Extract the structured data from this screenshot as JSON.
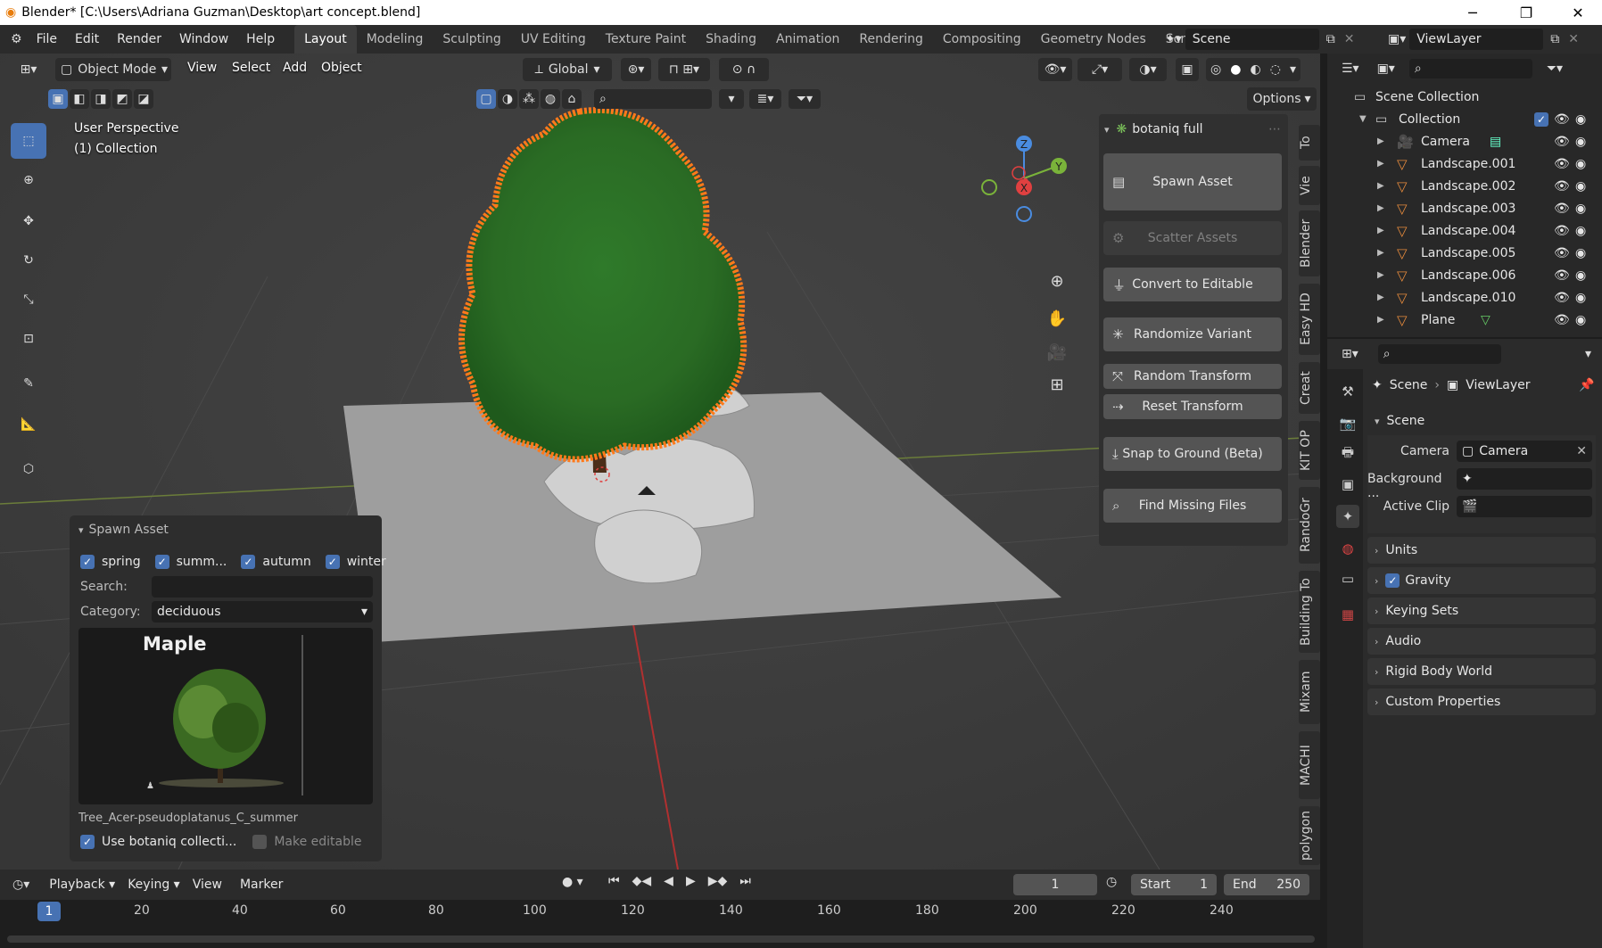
{
  "window": {
    "title": "Blender* [C:\\Users\\Adriana Guzman\\Desktop\\art concept.blend]",
    "minimize": "─",
    "maximize": "❐",
    "close": "✕"
  },
  "menu": {
    "items": [
      "File",
      "Edit",
      "Render",
      "Window",
      "Help"
    ],
    "workspaces": [
      "Layout",
      "Modeling",
      "Sculpting",
      "UV Editing",
      "Texture Paint",
      "Shading",
      "Animation",
      "Rendering",
      "Compositing",
      "Geometry Nodes",
      "Scripting"
    ],
    "active_workspace": "Layout",
    "scene": "Scene",
    "view_layer": "ViewLayer"
  },
  "viewport": {
    "mode": "Object Mode",
    "menus": [
      "View",
      "Select",
      "Add",
      "Object"
    ],
    "orientation": "Global",
    "options": "Options",
    "perspective": "User Perspective",
    "collection": "(1) Collection",
    "gizmo": {
      "x": "X",
      "y": "Y",
      "z": "Z"
    }
  },
  "npanel": {
    "title": "botaniq full",
    "buttons": [
      "Spawn Asset",
      "Scatter Assets",
      "Convert to Editable",
      "Randomize Variant",
      "Random Transform",
      "Reset Transform",
      "Snap to Ground (Beta)",
      "Find Missing Files"
    ],
    "tabs": [
      "To",
      "Vie",
      "Blender",
      "Easy HD",
      "Creat",
      "KIT OP",
      "RandoGr",
      "Building To",
      "Mixam",
      "MACHI",
      "polygon"
    ]
  },
  "spawn_asset": {
    "title": "Spawn Asset",
    "seasons": [
      "spring",
      "summ...",
      "autumn",
      "winter"
    ],
    "search_label": "Search:",
    "search_value": "",
    "category_label": "Category:",
    "category_value": "deciduous",
    "preview_title": "Maple",
    "asset_name": "Tree_Acer-pseudoplatanus_C_summer",
    "use_collection": "Use botaniq collecti...",
    "make_editable": "Make editable"
  },
  "outliner": {
    "root": "Scene Collection",
    "collection": "Collection",
    "items": [
      "Camera",
      "Landscape.001",
      "Landscape.002",
      "Landscape.003",
      "Landscape.004",
      "Landscape.005",
      "Landscape.006",
      "Landscape.010",
      "Plane"
    ]
  },
  "properties": {
    "breadcrumb_scene": "Scene",
    "breadcrumb_sep": "›",
    "breadcrumb_layer": "ViewLayer",
    "section": "Scene",
    "camera_label": "Camera",
    "camera_value": "Camera",
    "background_label": "Background ...",
    "active_clip_label": "Active Clip",
    "sections": [
      "Units",
      "Gravity",
      "Keying Sets",
      "Audio",
      "Rigid Body World",
      "Custom Properties"
    ]
  },
  "timeline": {
    "menus": [
      "Playback",
      "Keying",
      "View",
      "Marker"
    ],
    "current_frame": "1",
    "start_label": "Start",
    "start": "1",
    "end_label": "End",
    "end": "250",
    "ticks": [
      "1",
      "20",
      "40",
      "60",
      "80",
      "100",
      "120",
      "140",
      "160",
      "180",
      "200",
      "220",
      "240"
    ]
  },
  "colors": {
    "accent": "#4772b3",
    "selection_outline": "#ff7a1a",
    "viewport_bg": "#3d3d3d"
  }
}
